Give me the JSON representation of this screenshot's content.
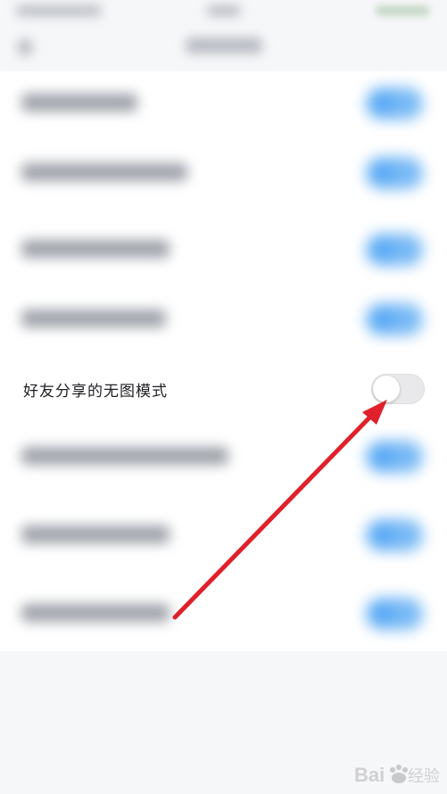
{
  "settings": {
    "highlighted_item": {
      "label": "好友分享的无图模式",
      "toggle_state": "off"
    }
  },
  "colors": {
    "accent_toggle": "#5aaaf5",
    "annotation_arrow": "#e0202a",
    "text_primary": "#1f1f24"
  },
  "watermark": {
    "brand": "Baidu经验"
  }
}
